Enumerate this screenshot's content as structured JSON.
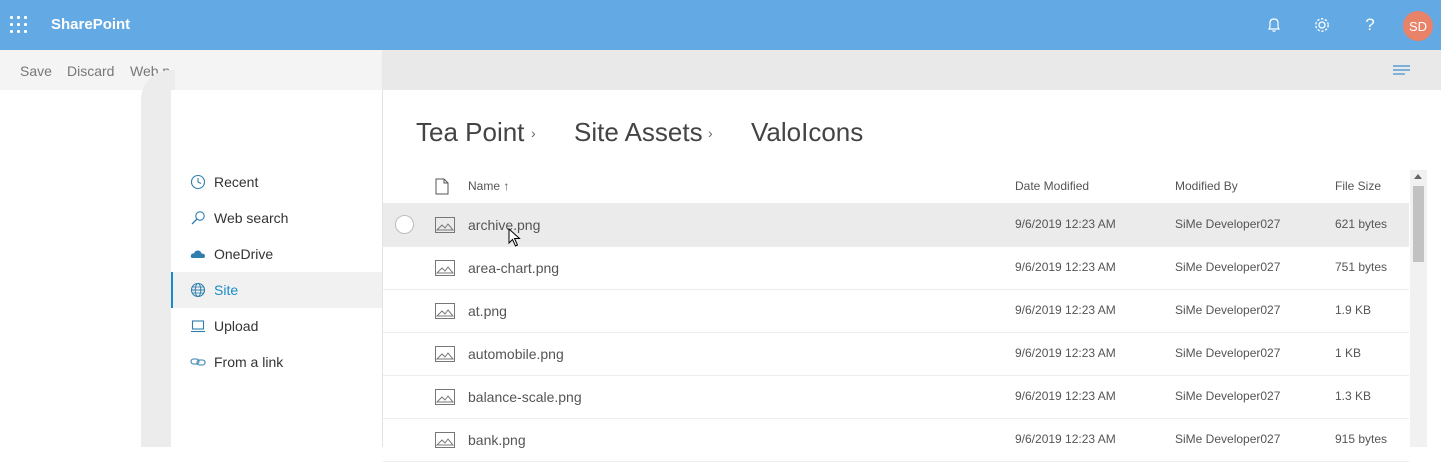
{
  "suitebar": {
    "brand": "SharePoint",
    "avatar_initials": "SD",
    "icons": [
      "app-launcher-icon",
      "bell-icon",
      "gear-icon",
      "help-icon"
    ],
    "help_glyph": "?"
  },
  "commandbar": {
    "save_label": "Save",
    "discard_label": "Discard",
    "web_label": "Web p"
  },
  "nav": {
    "items": [
      {
        "label": "Recent",
        "icon": "clock-icon"
      },
      {
        "label": "Web search",
        "icon": "search-icon"
      },
      {
        "label": "OneDrive",
        "icon": "onedrive-icon"
      },
      {
        "label": "Site",
        "icon": "globe-icon",
        "selected": true
      },
      {
        "label": "Upload",
        "icon": "upload-icon"
      },
      {
        "label": "From a link",
        "icon": "link-icon"
      }
    ]
  },
  "breadcrumb": [
    "Tea Point",
    "Site Assets",
    "ValoIcons"
  ],
  "table": {
    "headers": {
      "name": "Name ↑",
      "date": "Date Modified",
      "by": "Modified By",
      "size": "File Size"
    },
    "rows": [
      {
        "name": "archive.png",
        "date": "9/6/2019 12:23 AM",
        "by": "SiMe Developer027",
        "size": "621 bytes"
      },
      {
        "name": "area-chart.png",
        "date": "9/6/2019 12:23 AM",
        "by": "SiMe Developer027",
        "size": "751 bytes"
      },
      {
        "name": "at.png",
        "date": "9/6/2019 12:23 AM",
        "by": "SiMe Developer027",
        "size": "1.9 KB"
      },
      {
        "name": "automobile.png",
        "date": "9/6/2019 12:23 AM",
        "by": "SiMe Developer027",
        "size": "1 KB"
      },
      {
        "name": "balance-scale.png",
        "date": "9/6/2019 12:23 AM",
        "by": "SiMe Developer027",
        "size": "1.3 KB"
      },
      {
        "name": "bank.png",
        "date": "9/6/2019 12:23 AM",
        "by": "SiMe Developer027",
        "size": "915 bytes"
      }
    ]
  },
  "colors": {
    "suitebar": "#63a9e3",
    "accent": "#1c8cc7",
    "avatar": "#e8836a"
  }
}
